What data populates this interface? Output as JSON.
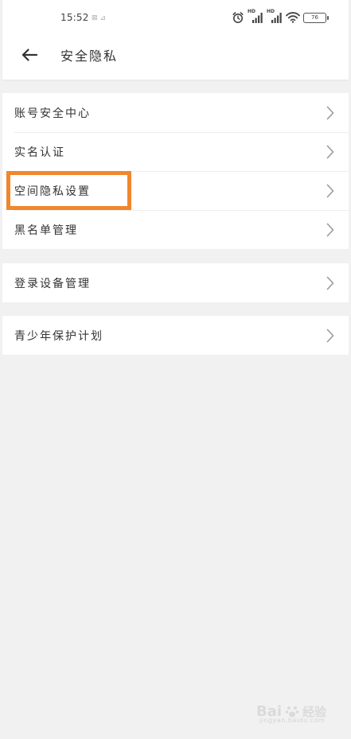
{
  "status_bar": {
    "time": "15:52",
    "small_icons": "⊠ ⊿",
    "signal1_label": "HD",
    "signal2_label": "HD",
    "battery_level": "76"
  },
  "header": {
    "title": "安全隐私"
  },
  "groups": [
    {
      "items": [
        {
          "label": "账号安全中心"
        },
        {
          "label": "实名认证"
        },
        {
          "label": "空间隐私设置"
        },
        {
          "label": "黑名单管理"
        }
      ]
    },
    {
      "items": [
        {
          "label": "登录设备管理"
        }
      ]
    },
    {
      "items": [
        {
          "label": "青少年保护计划"
        }
      ]
    }
  ],
  "highlight": {
    "color": "#f1872d",
    "target": "空间隐私设置"
  },
  "watermark": {
    "brand": "Bai",
    "brand_suffix": "经验",
    "sub": "jingyan.baidu.com"
  },
  "colors": {
    "background": "#f0f1f0",
    "card": "#ffffff",
    "text": "#333333",
    "chevron": "#9a9a9a"
  }
}
